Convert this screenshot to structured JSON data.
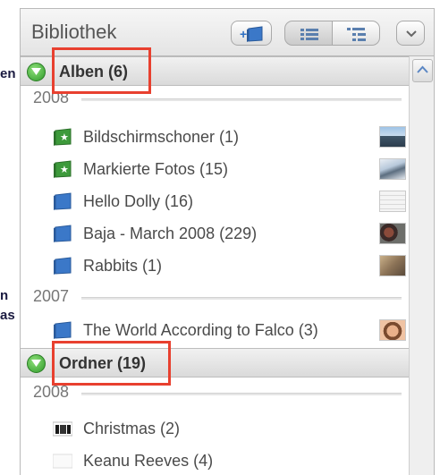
{
  "left_fragments": [
    "en",
    "n",
    "as"
  ],
  "header": {
    "title": "Bibliothek",
    "add_button_icon": "add-album-icon",
    "view_list_icon": "list-view-icon",
    "view_tree_icon": "tree-view-icon",
    "menu_icon": "chevron-down-icon"
  },
  "sections": {
    "albums": {
      "label": "Alben (6)"
    },
    "folders": {
      "label": "Ordner (19)"
    }
  },
  "albums": {
    "year_2008": "2008",
    "year_2007": "2007",
    "items": [
      {
        "label": "Bildschirmschoner (1)",
        "icon": "smart-album-icon"
      },
      {
        "label": "Markierte Fotos (15)",
        "icon": "smart-album-icon"
      },
      {
        "label": "Hello Dolly (16)",
        "icon": "album-icon"
      },
      {
        "label": "Baja - March 2008 (229)",
        "icon": "album-icon"
      },
      {
        "label": "Rabbits (1)",
        "icon": "album-icon"
      },
      {
        "label": "The World According to Falco (3)",
        "icon": "album-icon"
      }
    ]
  },
  "folders": {
    "year_2008": "2008",
    "items": [
      {
        "label": "Christmas (2)",
        "icon": "folder-thumb-icon"
      },
      {
        "label": "Keanu Reeves (4)",
        "icon": "folder-thumb-icon"
      }
    ]
  },
  "colors": {
    "highlight": "#e8402f",
    "toggle": "#3aa82f",
    "album_icon": "#3b78c8",
    "smart_album_icon": "#3d9a3b"
  }
}
